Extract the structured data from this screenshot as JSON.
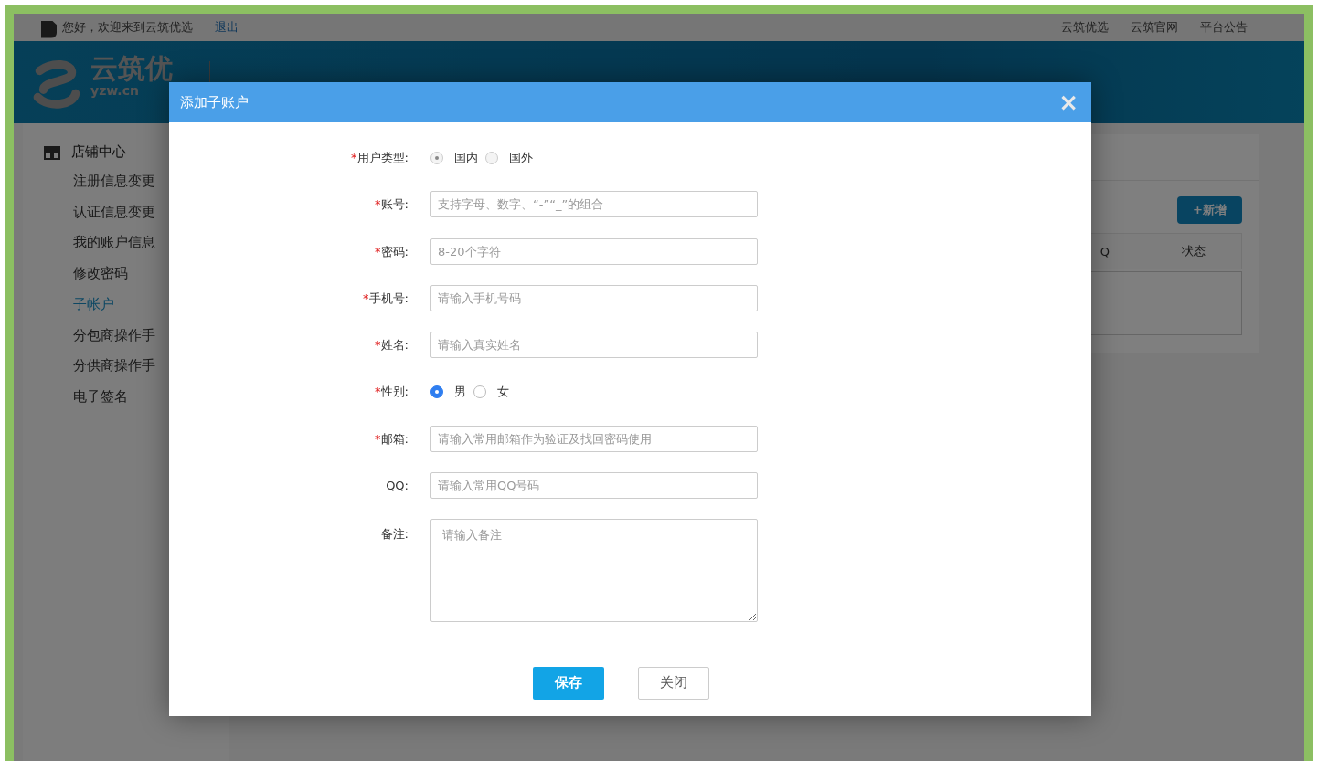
{
  "top_bar": {
    "greeting": "您好，欢迎来到云筑优选",
    "logout": "退出",
    "links": [
      "云筑优选",
      "云筑官网",
      "平台公告"
    ]
  },
  "header": {
    "logo_text": "云筑优",
    "logo_domain": "yzw.cn"
  },
  "sidebar": {
    "title": "店铺中心",
    "items": [
      {
        "label": "注册信息变更",
        "selected": false
      },
      {
        "label": "认证信息变更",
        "selected": false
      },
      {
        "label": "我的账户信息",
        "selected": false
      },
      {
        "label": "修改密码",
        "selected": false
      },
      {
        "label": "子帐户",
        "selected": true
      },
      {
        "label": "分包商操作手",
        "selected": false
      },
      {
        "label": "分供商操作手",
        "selected": false
      },
      {
        "label": "电子签名",
        "selected": false
      }
    ]
  },
  "panel": {
    "add_button": "+新增",
    "table": {
      "columns": [
        "Q",
        "状态"
      ]
    }
  },
  "dialog": {
    "title": "添加子账户",
    "close": "×",
    "fields": [
      {
        "kind": "radio",
        "label": "用户类型:",
        "required_mark": "*",
        "options": [
          {
            "label": "国内",
            "selected": true,
            "disabled": true
          },
          {
            "label": "国外",
            "selected": false,
            "disabled": true
          }
        ]
      },
      {
        "kind": "text",
        "label": "账号:",
        "required_mark": "*",
        "placeholder": "支持字母、数字、“-”“_”的组合"
      },
      {
        "kind": "text",
        "label": "密码:",
        "required_mark": "*",
        "placeholder": "8-20个字符"
      },
      {
        "kind": "text",
        "label": "手机号:",
        "required_mark": "*",
        "placeholder": "请输入手机号码"
      },
      {
        "kind": "text",
        "label": "姓名:",
        "required_mark": "*",
        "placeholder": "请输入真实姓名"
      },
      {
        "kind": "radio",
        "label": "性别:",
        "required_mark": "*",
        "options": [
          {
            "label": "男",
            "selected": true,
            "disabled": false
          },
          {
            "label": "女",
            "selected": false,
            "disabled": false
          }
        ]
      },
      {
        "kind": "text",
        "label": "邮箱:",
        "required_mark": "*",
        "placeholder": "请输入常用邮箱作为验证及找回密码使用"
      },
      {
        "kind": "text",
        "label": "QQ:",
        "placeholder": "请输入常用QQ号码"
      },
      {
        "kind": "textarea",
        "label": "备注:",
        "placeholder": "请输入备注"
      }
    ],
    "buttons": [
      {
        "label": "保存",
        "kind": "primary"
      },
      {
        "label": "关闭",
        "kind": "default"
      }
    ]
  }
}
